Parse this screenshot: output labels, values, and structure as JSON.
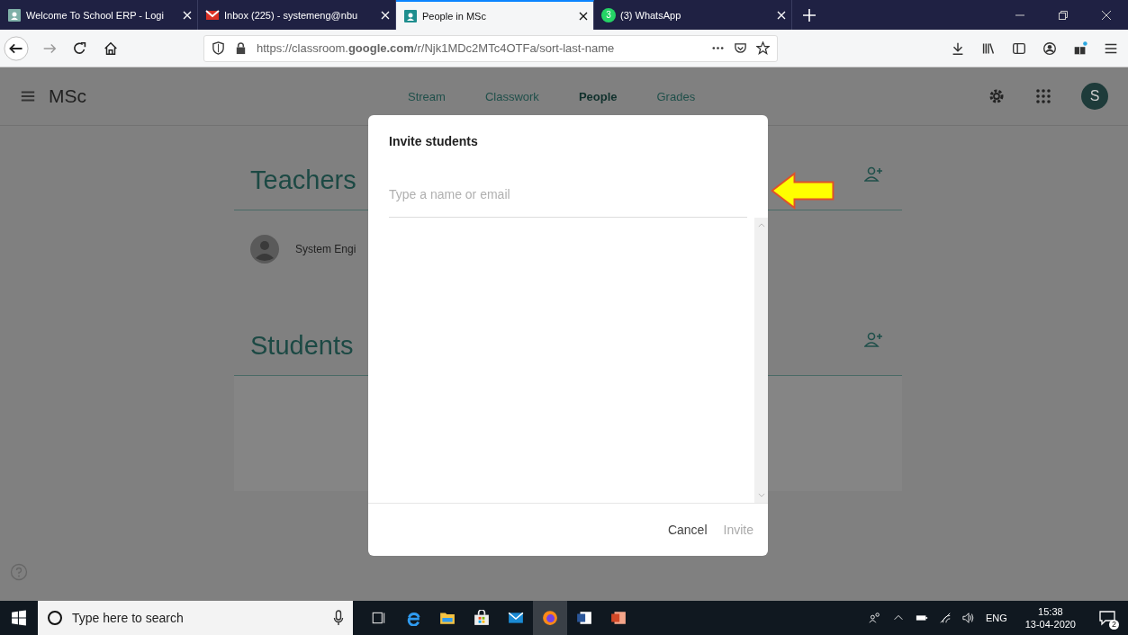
{
  "browser_tabs": [
    {
      "title": "Welcome To School ERP - Logi",
      "kind": "page",
      "selected": false
    },
    {
      "title": "Inbox (225) - systemeng@nbu",
      "kind": "mail",
      "selected": false
    },
    {
      "title": "People in MSc",
      "kind": "page",
      "selected": true
    },
    {
      "title": "(3) WhatsApp",
      "kind": "chat",
      "badge": "3",
      "selected": false
    }
  ],
  "address_bar": {
    "url": "https://classroom.**google.com**/r/Njk1MDc2MTc4OTFa/sort-last-name"
  },
  "app_bar": {
    "title": "MSc",
    "avatar": "S"
  },
  "nav_tabs": [
    {
      "label": "Stream",
      "selected": false
    },
    {
      "label": "Classwork",
      "selected": false
    },
    {
      "label": "People",
      "selected": true
    },
    {
      "label": "Grades",
      "selected": false
    }
  ],
  "sections": [
    {
      "heading": "Teachers",
      "members": [
        "System Engi"
      ]
    },
    {
      "heading": "Students"
    }
  ],
  "dialog": {
    "title": "Invite students",
    "placeholder": "Type a name or email",
    "buttons": [
      {
        "label": "Cancel",
        "disabled": false
      },
      {
        "label": "Invite",
        "disabled": true
      }
    ]
  },
  "taskbar": {
    "search_placeholder": "Type here to search",
    "language": "ENG",
    "time": "15:38",
    "date": "13-04-2020",
    "notifications": "2"
  }
}
